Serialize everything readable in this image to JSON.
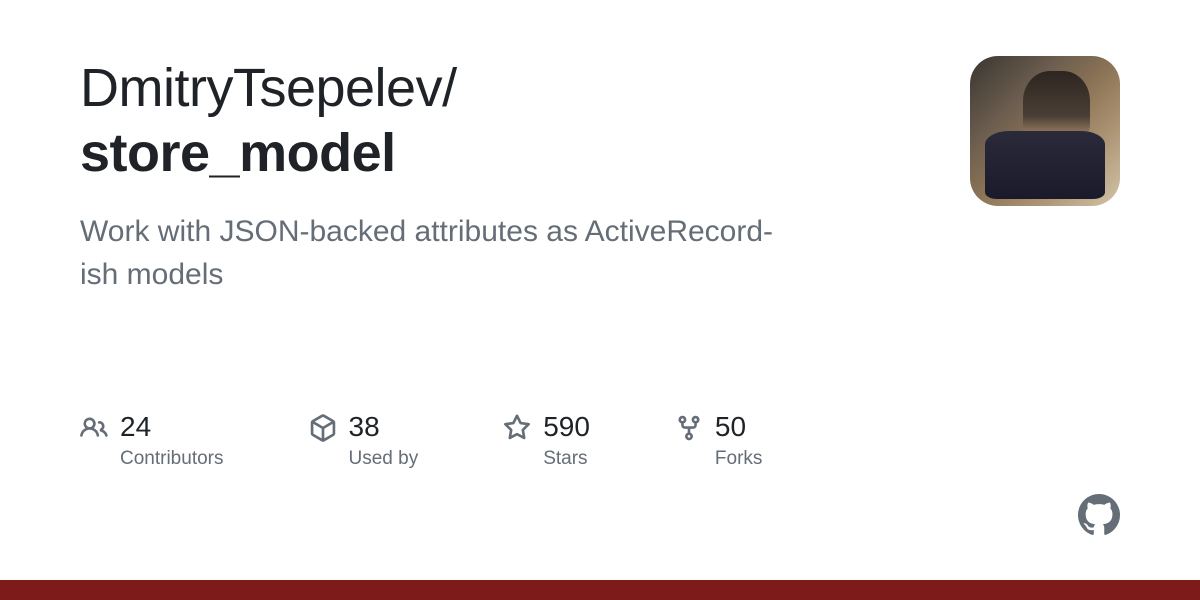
{
  "repo": {
    "owner": "DmitryTsepelev/",
    "name": "store_model",
    "description": "Work with JSON-backed attributes as ActiveRecord-ish models"
  },
  "stats": {
    "contributors": {
      "value": "24",
      "label": "Contributors"
    },
    "usedby": {
      "value": "38",
      "label": "Used by"
    },
    "stars": {
      "value": "590",
      "label": "Stars"
    },
    "forks": {
      "value": "50",
      "label": "Forks"
    }
  },
  "colors": {
    "accent": "#7d1a1a"
  }
}
